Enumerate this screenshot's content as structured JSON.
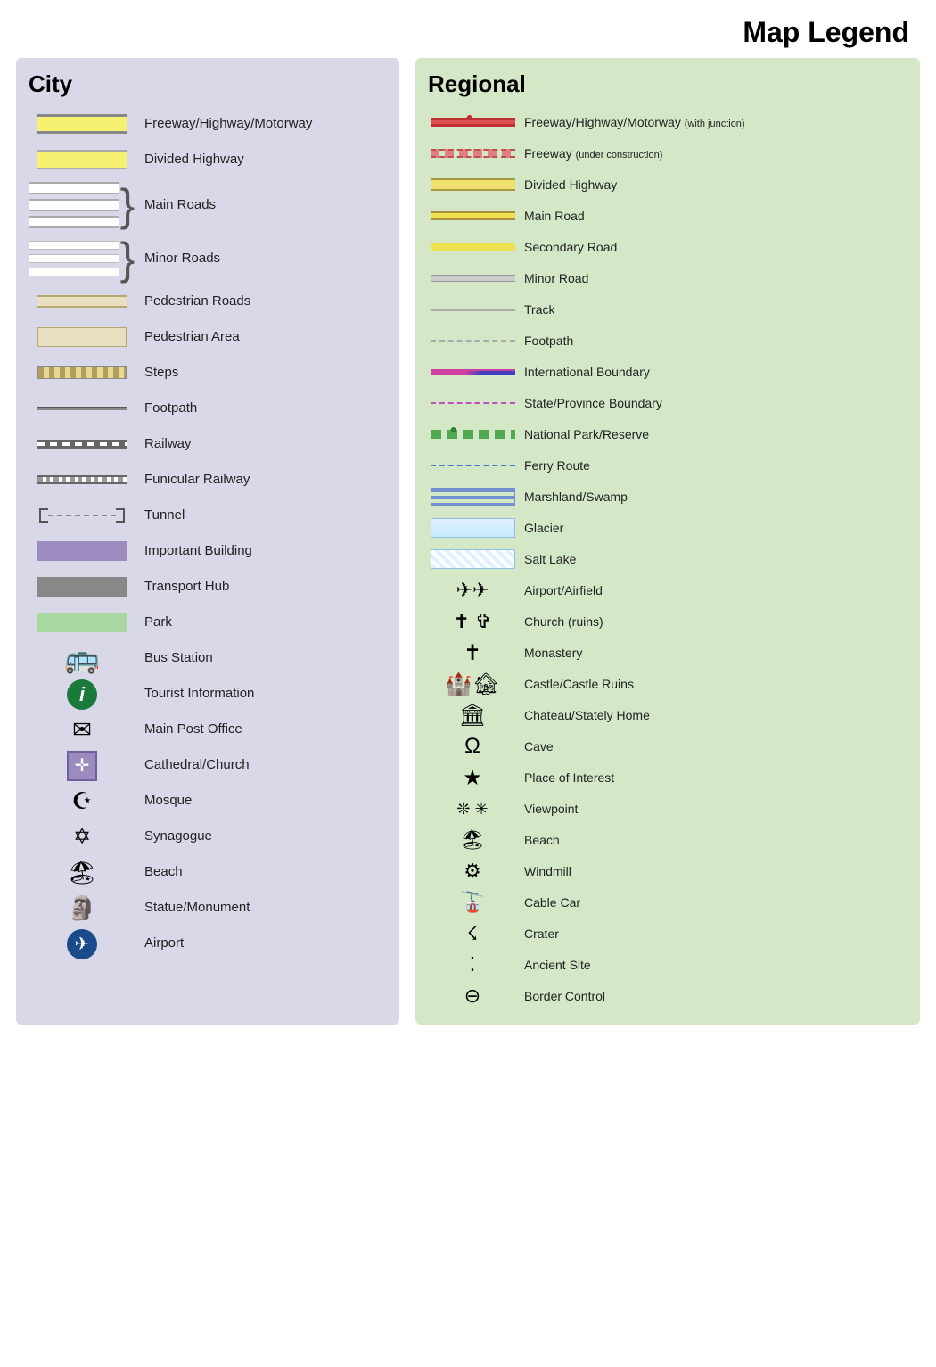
{
  "title": "Map Legend",
  "city": {
    "title": "City",
    "items": [
      {
        "id": "freeway",
        "label": "Freeway/Highway/Motorway",
        "type": "freeway"
      },
      {
        "id": "divided-highway",
        "label": "Divided Highway",
        "type": "divided"
      },
      {
        "id": "main-roads",
        "label": "Main Roads",
        "type": "main-roads"
      },
      {
        "id": "minor-roads",
        "label": "Minor Roads",
        "type": "minor-roads"
      },
      {
        "id": "pedestrian-roads",
        "label": "Pedestrian Roads",
        "type": "pedestrian-roads"
      },
      {
        "id": "pedestrian-area",
        "label": "Pedestrian Area",
        "type": "pedestrian-area"
      },
      {
        "id": "steps",
        "label": "Steps",
        "type": "steps"
      },
      {
        "id": "footpath",
        "label": "Footpath",
        "type": "footpath"
      },
      {
        "id": "railway",
        "label": "Railway",
        "type": "railway"
      },
      {
        "id": "funicular",
        "label": "Funicular Railway",
        "type": "funicular"
      },
      {
        "id": "tunnel",
        "label": "Tunnel",
        "type": "tunnel"
      },
      {
        "id": "important-building",
        "label": "Important Building",
        "type": "important-building"
      },
      {
        "id": "transport-hub",
        "label": "Transport Hub",
        "type": "transport-hub"
      },
      {
        "id": "park",
        "label": "Park",
        "type": "park"
      },
      {
        "id": "bus-station",
        "label": "Bus Station",
        "icon": "🚌"
      },
      {
        "id": "tourist-info",
        "label": "Tourist Information",
        "icon": "ℹ",
        "iconColor": "#1a7a3a"
      },
      {
        "id": "post-office",
        "label": "Main Post Office",
        "icon": "✉"
      },
      {
        "id": "cathedral",
        "label": "Cathedral/Church",
        "icon": "✛",
        "iconColor": "#9b8bbf"
      },
      {
        "id": "mosque",
        "label": "Mosque",
        "icon": "☪"
      },
      {
        "id": "synagogue",
        "label": "Synagogue",
        "icon": "✡"
      },
      {
        "id": "beach-city",
        "label": "Beach",
        "icon": "🏖"
      },
      {
        "id": "statue",
        "label": "Statue/Monument",
        "icon": "🗿"
      },
      {
        "id": "airport-city",
        "label": "Airport",
        "icon": "✈"
      }
    ]
  },
  "regional": {
    "title": "Regional",
    "items": [
      {
        "id": "reg-freeway",
        "label": "Freeway/Highway/Motorway",
        "sublabel": "(with junction)",
        "type": "reg-freeway"
      },
      {
        "id": "reg-freeway-construction",
        "label": "Freeway (under construction)",
        "type": "reg-freeway-construction"
      },
      {
        "id": "reg-divided",
        "label": "Divided Highway",
        "type": "reg-divided"
      },
      {
        "id": "reg-main-road",
        "label": "Main Road",
        "type": "reg-main-road"
      },
      {
        "id": "reg-secondary-road",
        "label": "Secondary Road",
        "type": "reg-secondary-road"
      },
      {
        "id": "reg-minor-road",
        "label": "Minor Road",
        "type": "reg-minor-road"
      },
      {
        "id": "reg-track",
        "label": "Track",
        "type": "reg-track"
      },
      {
        "id": "reg-footpath",
        "label": "Footpath",
        "type": "reg-footpath"
      },
      {
        "id": "reg-intl-boundary",
        "label": "International Boundary",
        "type": "reg-intl-boundary"
      },
      {
        "id": "reg-state-boundary",
        "label": "State/Province Boundary",
        "type": "reg-state-boundary"
      },
      {
        "id": "reg-nat-park",
        "label": "National Park/Reserve",
        "type": "reg-nat-park"
      },
      {
        "id": "reg-ferry",
        "label": "Ferry Route",
        "type": "reg-ferry"
      },
      {
        "id": "reg-marshland",
        "label": "Marshland/Swamp",
        "type": "reg-marshland"
      },
      {
        "id": "reg-glacier",
        "label": "Glacier",
        "type": "reg-glacier"
      },
      {
        "id": "reg-salt-lake",
        "label": "Salt Lake",
        "type": "reg-salt-lake"
      },
      {
        "id": "reg-airport",
        "label": "Airport/Airfield",
        "icon": "✈✈"
      },
      {
        "id": "reg-church",
        "label": "Church (ruins)",
        "icon": "✝ ✝̶"
      },
      {
        "id": "reg-monastery",
        "label": "Monastery",
        "icon": "✝"
      },
      {
        "id": "reg-castle",
        "label": "Castle/Castle Ruins",
        "icon": "🏰🏚"
      },
      {
        "id": "reg-chateau",
        "label": "Chateau/Stately Home",
        "icon": "🏛"
      },
      {
        "id": "reg-cave",
        "label": "Cave",
        "icon": "Ω"
      },
      {
        "id": "reg-place-interest",
        "label": "Place of Interest",
        "icon": "★"
      },
      {
        "id": "reg-viewpoint",
        "label": "Viewpoint",
        "icon": "❊ ✳"
      },
      {
        "id": "reg-beach",
        "label": "Beach",
        "icon": "🏖"
      },
      {
        "id": "reg-windmill",
        "label": "Windmill",
        "icon": "⚙"
      },
      {
        "id": "reg-cable-car",
        "label": "Cable Car",
        "icon": "🚡"
      },
      {
        "id": "reg-crater",
        "label": "Crater",
        "icon": "☇"
      },
      {
        "id": "reg-ancient-site",
        "label": "Ancient Site",
        "icon": "⁚"
      },
      {
        "id": "reg-border-control",
        "label": "Border Control",
        "icon": "⊖"
      }
    ]
  }
}
